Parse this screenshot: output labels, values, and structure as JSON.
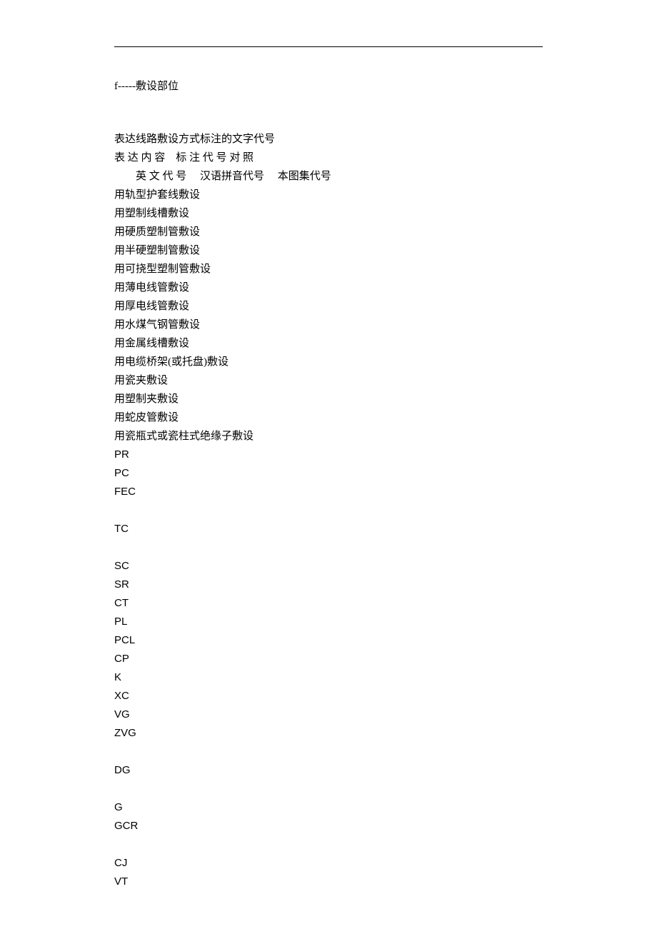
{
  "header_note": "f-----敷设部位",
  "section_title": "表达线路敷设方式标注的文字代号",
  "table_header_row1": "表  达  内  容　标  注  代  号  对  照",
  "table_header_row2": "　　英  文  代  号　 汉语拼音代号　 本图集代号",
  "methods": [
    "用轨型护套线敷设",
    "用塑制线槽敷设",
    "用硬质塑制管敷设",
    "用半硬塑制管敷设",
    "用可挠型塑制管敷设",
    "用薄电线管敷设",
    "用厚电线管敷设",
    "用水煤气钢管敷设",
    "用金属线槽敷设",
    "用电缆桥架(或托盘)敷设",
    "用瓷夹敷设",
    "用塑制夹敷设",
    "用蛇皮管敷设",
    "用瓷瓶式或瓷柱式绝缘子敷设"
  ],
  "codes_group1": [
    "PR",
    "PC",
    "FEC"
  ],
  "codes_group2": [
    "TC"
  ],
  "codes_group3": [
    "SC",
    "SR",
    "CT",
    "PL",
    "PCL",
    "CP",
    "K",
    "XC",
    "VG",
    "ZVG"
  ],
  "codes_group4": [
    "DG"
  ],
  "codes_group5": [
    "G",
    "GCR"
  ],
  "codes_group6": [
    "CJ",
    "VT"
  ]
}
